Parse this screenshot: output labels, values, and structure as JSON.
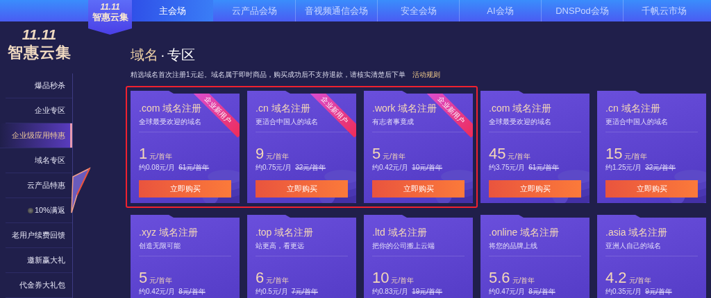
{
  "nav": {
    "badge": {
      "line1": "11.11",
      "line2": "智惠云集"
    },
    "tabs": [
      {
        "label": "主会场",
        "selected": true
      },
      {
        "label": "云产品会场",
        "selected": false
      },
      {
        "label": "音视频通信会场",
        "selected": false
      },
      {
        "label": "安全会场",
        "selected": false
      },
      {
        "label": "AI会场",
        "selected": false
      },
      {
        "label": "DNSPod会场",
        "selected": false
      },
      {
        "label": "千帆云市场",
        "selected": false
      }
    ]
  },
  "sidebar": {
    "logo": {
      "line1": "11.11",
      "line2": "智惠云集"
    },
    "items": [
      {
        "label": "爆品秒杀",
        "selected": false
      },
      {
        "label": "企业专区",
        "selected": false
      },
      {
        "label": "企业级应用特惠",
        "selected": true
      },
      {
        "label": "域名专区",
        "selected": false
      },
      {
        "label": "云产品特惠",
        "selected": false
      },
      {
        "label": "10%满返",
        "selected": false,
        "kind": "coin"
      },
      {
        "label": "老用户续费回馈",
        "selected": false
      },
      {
        "label": "邀新赢大礼",
        "selected": false
      },
      {
        "label": "代金券大礼包",
        "selected": false
      }
    ]
  },
  "section": {
    "title_highlight": "域名",
    "title_sep": "·",
    "title_rest": "专区",
    "description": "精选域名首次注册1元起。域名属于即时商品，购买成功后不支持退款，请核实清楚后下单",
    "rules_link": "活动规则"
  },
  "rows": [
    {
      "cards": [
        {
          "title": ".com 域名注册",
          "subtitle": "全球最受欢迎的域名",
          "price": "1",
          "unit": "元/首年",
          "monthly": "约0.08元/月",
          "original": "61元/首年",
          "button": "立即购买",
          "ribbon": "企业新用户",
          "highlighted": true
        },
        {
          "title": ".cn 域名注册",
          "subtitle": "更适合中国人的域名",
          "price": "9",
          "unit": "元/首年",
          "monthly": "约0.75元/月",
          "original": "32元/首年",
          "button": "立即购买",
          "ribbon": "企业新用户",
          "highlighted": true
        },
        {
          "title": ".work 域名注册",
          "subtitle": "有志者事竟成",
          "price": "5",
          "unit": "元/首年",
          "monthly": "约0.42元/月",
          "original": "10元/首年",
          "button": "立即购买",
          "ribbon": "企业新用户",
          "highlighted": true
        },
        {
          "title": ".com 域名注册",
          "subtitle": "全球最受欢迎的域名",
          "price": "45",
          "unit": "元/首年",
          "monthly": "约3.75元/月",
          "original": "61元/首年",
          "button": "立即购买",
          "highlighted": false
        },
        {
          "title": ".cn 域名注册",
          "subtitle": "更适合中国人的域名",
          "price": "15",
          "unit": "元/首年",
          "monthly": "约1.25元/月",
          "original": "32元/首年",
          "button": "立即购买",
          "highlighted": false
        }
      ]
    },
    {
      "cards": [
        {
          "title": ".xyz 域名注册",
          "subtitle": "创造无限可能",
          "price": "5",
          "unit": "元/首年",
          "monthly": "约0.42元/月",
          "original": "8元/首年",
          "highlighted": false
        },
        {
          "title": ".top 域名注册",
          "subtitle": "站更高，看更远",
          "price": "6",
          "unit": "元/首年",
          "monthly": "约0.5元/月",
          "original": "7元/首年",
          "highlighted": false
        },
        {
          "title": ".ltd 域名注册",
          "subtitle": "把你的公司搬上云端",
          "price": "10",
          "unit": "元/首年",
          "monthly": "约0.83元/月",
          "original": "19元/首年",
          "highlighted": false
        },
        {
          "title": ".online 域名注册",
          "subtitle": "将您的品牌上线",
          "price": "5.6",
          "unit": "元/首年",
          "monthly": "约0.47元/月",
          "original": "8元/首年",
          "highlighted": false
        },
        {
          "title": ".asia 域名注册",
          "subtitle": "亚洲人自己的域名",
          "price": "4.2",
          "unit": "元/首年",
          "monthly": "约0.35元/月",
          "original": "9元/首年",
          "highlighted": false
        }
      ]
    }
  ]
}
